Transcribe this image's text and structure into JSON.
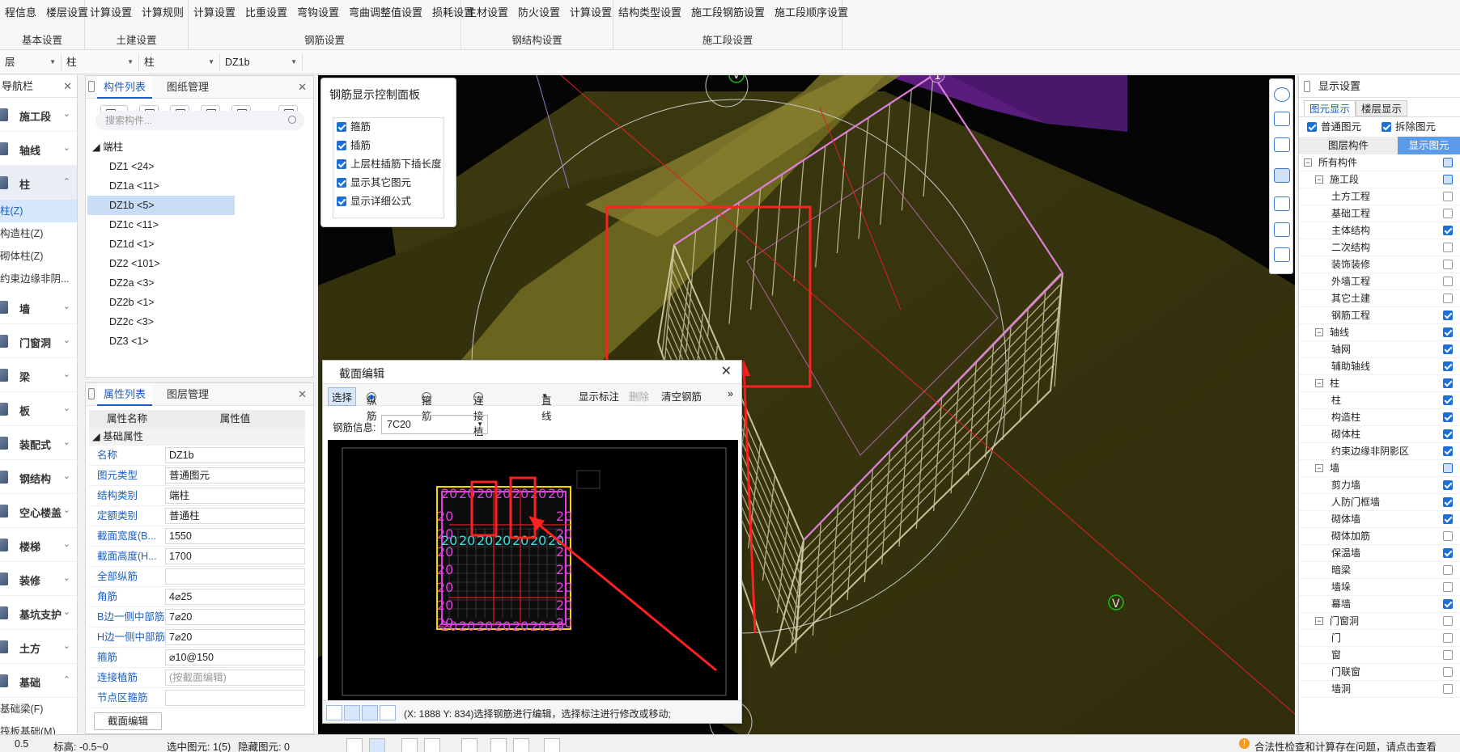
{
  "ribbon": {
    "groups": [
      {
        "title": "基本设置",
        "items": [
          "程信息",
          "楼层设置"
        ]
      },
      {
        "title": "土建设置",
        "items": [
          "计算设置",
          "计算规则"
        ]
      },
      {
        "title": "钢筋设置",
        "items": [
          "计算设置",
          "比重设置",
          "弯钩设置",
          "弯曲调整值设置",
          "损耗设置"
        ]
      },
      {
        "title": "钢结构设置",
        "items": [
          "主材设置",
          "防火设置",
          "计算设置"
        ]
      },
      {
        "title": "施工段设置",
        "items": [
          "结构类型设置",
          "施工段钢筋设置",
          "施工段顺序设置"
        ]
      }
    ]
  },
  "selectors": [
    "层",
    "柱",
    "柱",
    "DZ1b"
  ],
  "leftnav": {
    "title": "导航栏",
    "items": [
      {
        "label": "施工段",
        "chev": "⌄"
      },
      {
        "label": "轴线",
        "chev": "⌄"
      },
      {
        "label": "柱",
        "chev": "⌃"
      }
    ],
    "subitems": [
      "柱(Z)",
      "构造柱(Z)",
      "砌体柱(Z)",
      "约束边缘非阴..."
    ],
    "items2": [
      {
        "label": "墙",
        "chev": "⌄"
      },
      {
        "label": "门窗洞",
        "chev": "⌄"
      },
      {
        "label": "梁",
        "chev": "⌄"
      },
      {
        "label": "板",
        "chev": "⌄"
      },
      {
        "label": "装配式",
        "chev": "⌄"
      },
      {
        "label": "钢结构",
        "chev": "⌄"
      },
      {
        "label": "空心楼盖",
        "chev": "⌄"
      },
      {
        "label": "楼梯",
        "chev": "⌄"
      },
      {
        "label": "装修",
        "chev": "⌄"
      },
      {
        "label": "基坑支护",
        "chev": "⌄"
      },
      {
        "label": "土方",
        "chev": "⌄"
      },
      {
        "label": "基础",
        "chev": "⌃"
      }
    ],
    "tail": [
      "基础梁(F)",
      "筏板基础(M)"
    ]
  },
  "complist": {
    "tabs": [
      "构件列表",
      "图纸管理"
    ],
    "search_placeholder": "搜索构件...",
    "root": "◢ 端柱",
    "leaves": [
      "DZ1 <24>",
      "DZ1a <11>",
      "DZ1b <5>",
      "DZ1c <11>",
      "DZ1d <1>",
      "DZ2 <101>",
      "DZ2a <3>",
      "DZ2b <1>",
      "DZ2c <3>",
      "DZ3 <1>"
    ]
  },
  "props": {
    "tabs": [
      "属性列表",
      "图层管理"
    ],
    "head_name": "属性名称",
    "head_value": "属性值",
    "group": "◢ 基础属性",
    "rows": [
      {
        "name": "名称",
        "value": "DZ1b"
      },
      {
        "name": "图元类型",
        "value": "普通图元"
      },
      {
        "name": "结构类别",
        "value": "端柱"
      },
      {
        "name": "定额类别",
        "value": "普通柱"
      },
      {
        "name": "截面宽度(B...",
        "value": "1550"
      },
      {
        "name": "截面高度(H...",
        "value": "1700"
      },
      {
        "name": "全部纵筋",
        "value": ""
      },
      {
        "name": "角筋",
        "value": "4⌀25"
      },
      {
        "name": "B边一侧中部筋",
        "value": "7⌀20"
      },
      {
        "name": "H边一侧中部筋",
        "value": "7⌀20"
      },
      {
        "name": "箍筋",
        "value": "⌀10@150"
      },
      {
        "name": "连接植筋",
        "value": "(按截面编辑)"
      },
      {
        "name": "节点区箍筋",
        "value": ""
      }
    ],
    "foot_button": "截面编辑"
  },
  "ctrlpanel": {
    "title": "钢筋显示控制面板",
    "checks": [
      "箍筋",
      "插筋",
      "上层柱插筋下插长度",
      "显示其它图元",
      "显示详细公式"
    ]
  },
  "secedit": {
    "title": "截面编辑",
    "select_btn": "选择",
    "radios": [
      "纵筋",
      "箍筋",
      "连接植筋"
    ],
    "tools": [
      "直线",
      "显示标注",
      "删除",
      "清空钢筋"
    ],
    "info_label": "钢筋信息:",
    "info_value": "7C20",
    "status_text": "(X: 1888 Y: 834)选择钢筋进行编辑，选择标注进行修改或移动;"
  },
  "scene": {
    "axis_marks": [
      "V",
      "1",
      "V"
    ]
  },
  "display": {
    "title": "显示设置",
    "tabs": [
      "图元显示",
      "楼层显示"
    ],
    "opts": [
      "普通图元",
      "拆除图元"
    ],
    "head_left": "图层构件",
    "head_right": "显示图元",
    "rows": [
      {
        "label": "所有构件",
        "level": 0,
        "toggle": "−",
        "state": "part"
      },
      {
        "label": "施工段",
        "level": 1,
        "toggle": "−",
        "state": "part"
      },
      {
        "label": "土方工程",
        "level": 2,
        "state": "off"
      },
      {
        "label": "基础工程",
        "level": 2,
        "state": "off"
      },
      {
        "label": "主体结构",
        "level": 2,
        "state": "on"
      },
      {
        "label": "二次结构",
        "level": 2,
        "state": "off"
      },
      {
        "label": "装饰装修",
        "level": 2,
        "state": "off"
      },
      {
        "label": "外墙工程",
        "level": 2,
        "state": "off"
      },
      {
        "label": "其它土建",
        "level": 2,
        "state": "off"
      },
      {
        "label": "钢筋工程",
        "level": 2,
        "state": "on"
      },
      {
        "label": "轴线",
        "level": 1,
        "toggle": "−",
        "state": "on"
      },
      {
        "label": "轴网",
        "level": 2,
        "state": "on"
      },
      {
        "label": "辅助轴线",
        "level": 2,
        "state": "on"
      },
      {
        "label": "柱",
        "level": 1,
        "toggle": "−",
        "state": "on"
      },
      {
        "label": "柱",
        "level": 2,
        "state": "on"
      },
      {
        "label": "构造柱",
        "level": 2,
        "state": "on"
      },
      {
        "label": "砌体柱",
        "level": 2,
        "state": "on"
      },
      {
        "label": "约束边缘非阴影区",
        "level": 2,
        "state": "on"
      },
      {
        "label": "墙",
        "level": 1,
        "toggle": "−",
        "state": "part"
      },
      {
        "label": "剪力墙",
        "level": 2,
        "state": "on"
      },
      {
        "label": "人防门框墙",
        "level": 2,
        "state": "on"
      },
      {
        "label": "砌体墙",
        "level": 2,
        "state": "on"
      },
      {
        "label": "砌体加筋",
        "level": 2,
        "state": "off"
      },
      {
        "label": "保温墙",
        "level": 2,
        "state": "on"
      },
      {
        "label": "暗梁",
        "level": 2,
        "state": "off"
      },
      {
        "label": "墙垛",
        "level": 2,
        "state": "off"
      },
      {
        "label": "幕墙",
        "level": 2,
        "state": "on"
      },
      {
        "label": "门窗洞",
        "level": 1,
        "toggle": "−",
        "state": "off"
      },
      {
        "label": "门",
        "level": 2,
        "state": "off"
      },
      {
        "label": "窗",
        "level": 2,
        "state": "off"
      },
      {
        "label": "门联窗",
        "level": 2,
        "state": "off"
      },
      {
        "label": "墙洞",
        "level": 2,
        "state": "off"
      }
    ]
  },
  "statusbar": {
    "scale": "0.5",
    "elev": "标高:  -0.5~0",
    "selected": "选中图元: 1(5)",
    "hidden": "隐藏图元: 0",
    "warning": "合法性检查和计算存在问题，请点击查看"
  }
}
